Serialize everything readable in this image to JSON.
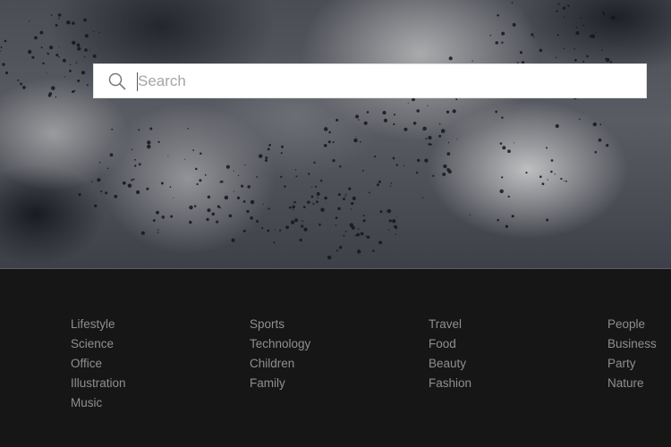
{
  "search": {
    "placeholder": "Search",
    "value": "",
    "icon": "search-icon"
  },
  "categories": {
    "column_1": [
      "Lifestyle",
      "Science",
      "Office",
      "Illustration",
      "Music"
    ],
    "column_2": [
      "Sports",
      "Technology",
      "Children",
      "Family"
    ],
    "column_3": [
      "Travel",
      "Food",
      "Beauty",
      "Fashion"
    ],
    "column_4": [
      "People",
      "Business",
      "Party",
      "Nature"
    ]
  },
  "colors": {
    "footer_background": "#161616",
    "link_text": "#8f8f8f",
    "search_background": "#ffffff"
  }
}
